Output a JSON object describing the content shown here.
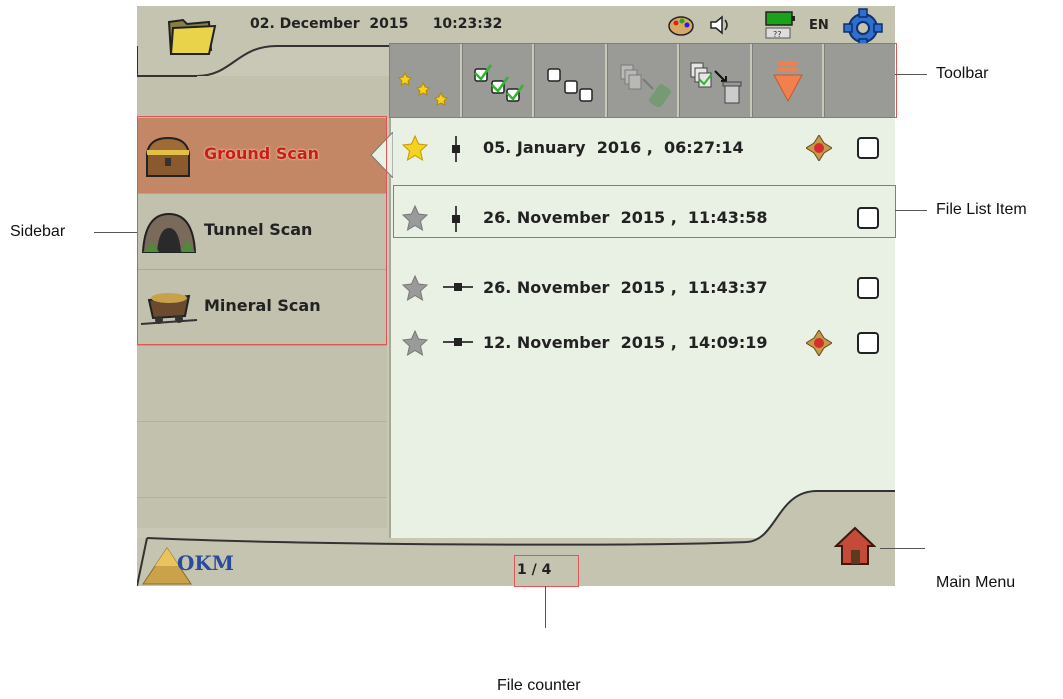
{
  "header": {
    "date": "02. December  2015",
    "time": "10:23:32",
    "language": "EN"
  },
  "toolbar_tools": [
    {
      "name": "select-favorites-tool",
      "icon": "stars-icon"
    },
    {
      "name": "select-all-tool",
      "icon": "checked-boxes-icon"
    },
    {
      "name": "deselect-all-tool",
      "icon": "empty-boxes-icon"
    },
    {
      "name": "export-usb-tool",
      "icon": "usb-export-icon"
    },
    {
      "name": "delete-tool",
      "icon": "trash-files-icon"
    },
    {
      "name": "sort-tool",
      "icon": "sort-down-arrow-icon"
    },
    {
      "name": "empty-tool",
      "icon": ""
    }
  ],
  "sidebar": {
    "items": [
      {
        "label": "Ground Scan",
        "icon": "treasure-chest-icon",
        "active": true
      },
      {
        "label": "Tunnel Scan",
        "icon": "tunnel-icon",
        "active": false
      },
      {
        "label": "Mineral Scan",
        "icon": "mine-cart-icon",
        "active": false
      }
    ]
  },
  "files": [
    {
      "date": "05. January  2016 ,  06:27:14",
      "favorite": true,
      "sensor": "vertical",
      "compass": true
    },
    {
      "date": "26. November  2015 ,  11:43:58",
      "favorite": false,
      "sensor": "vertical",
      "compass": false
    },
    {
      "date": "26. November  2015 ,  11:43:37",
      "favorite": false,
      "sensor": "horizontal",
      "compass": false
    },
    {
      "date": "12. November  2015 ,  14:09:19",
      "favorite": false,
      "sensor": "horizontal",
      "compass": true
    }
  ],
  "footer": {
    "counter": "1 / 4",
    "logo_text": "OKM"
  },
  "annotations": {
    "toolbar": "Toolbar",
    "sidebar": "Sidebar",
    "file_list_item": "File List Item",
    "main_menu": "Main Menu",
    "file_counter": "File counter"
  },
  "colors": {
    "frame": "#c9c8b6",
    "active_tab": "#c48766",
    "active_label": "#cc1b1b",
    "list_bg": "#e9f0e4",
    "toolbar_bg": "#9a9a96",
    "annotation_box": "#e05656"
  }
}
